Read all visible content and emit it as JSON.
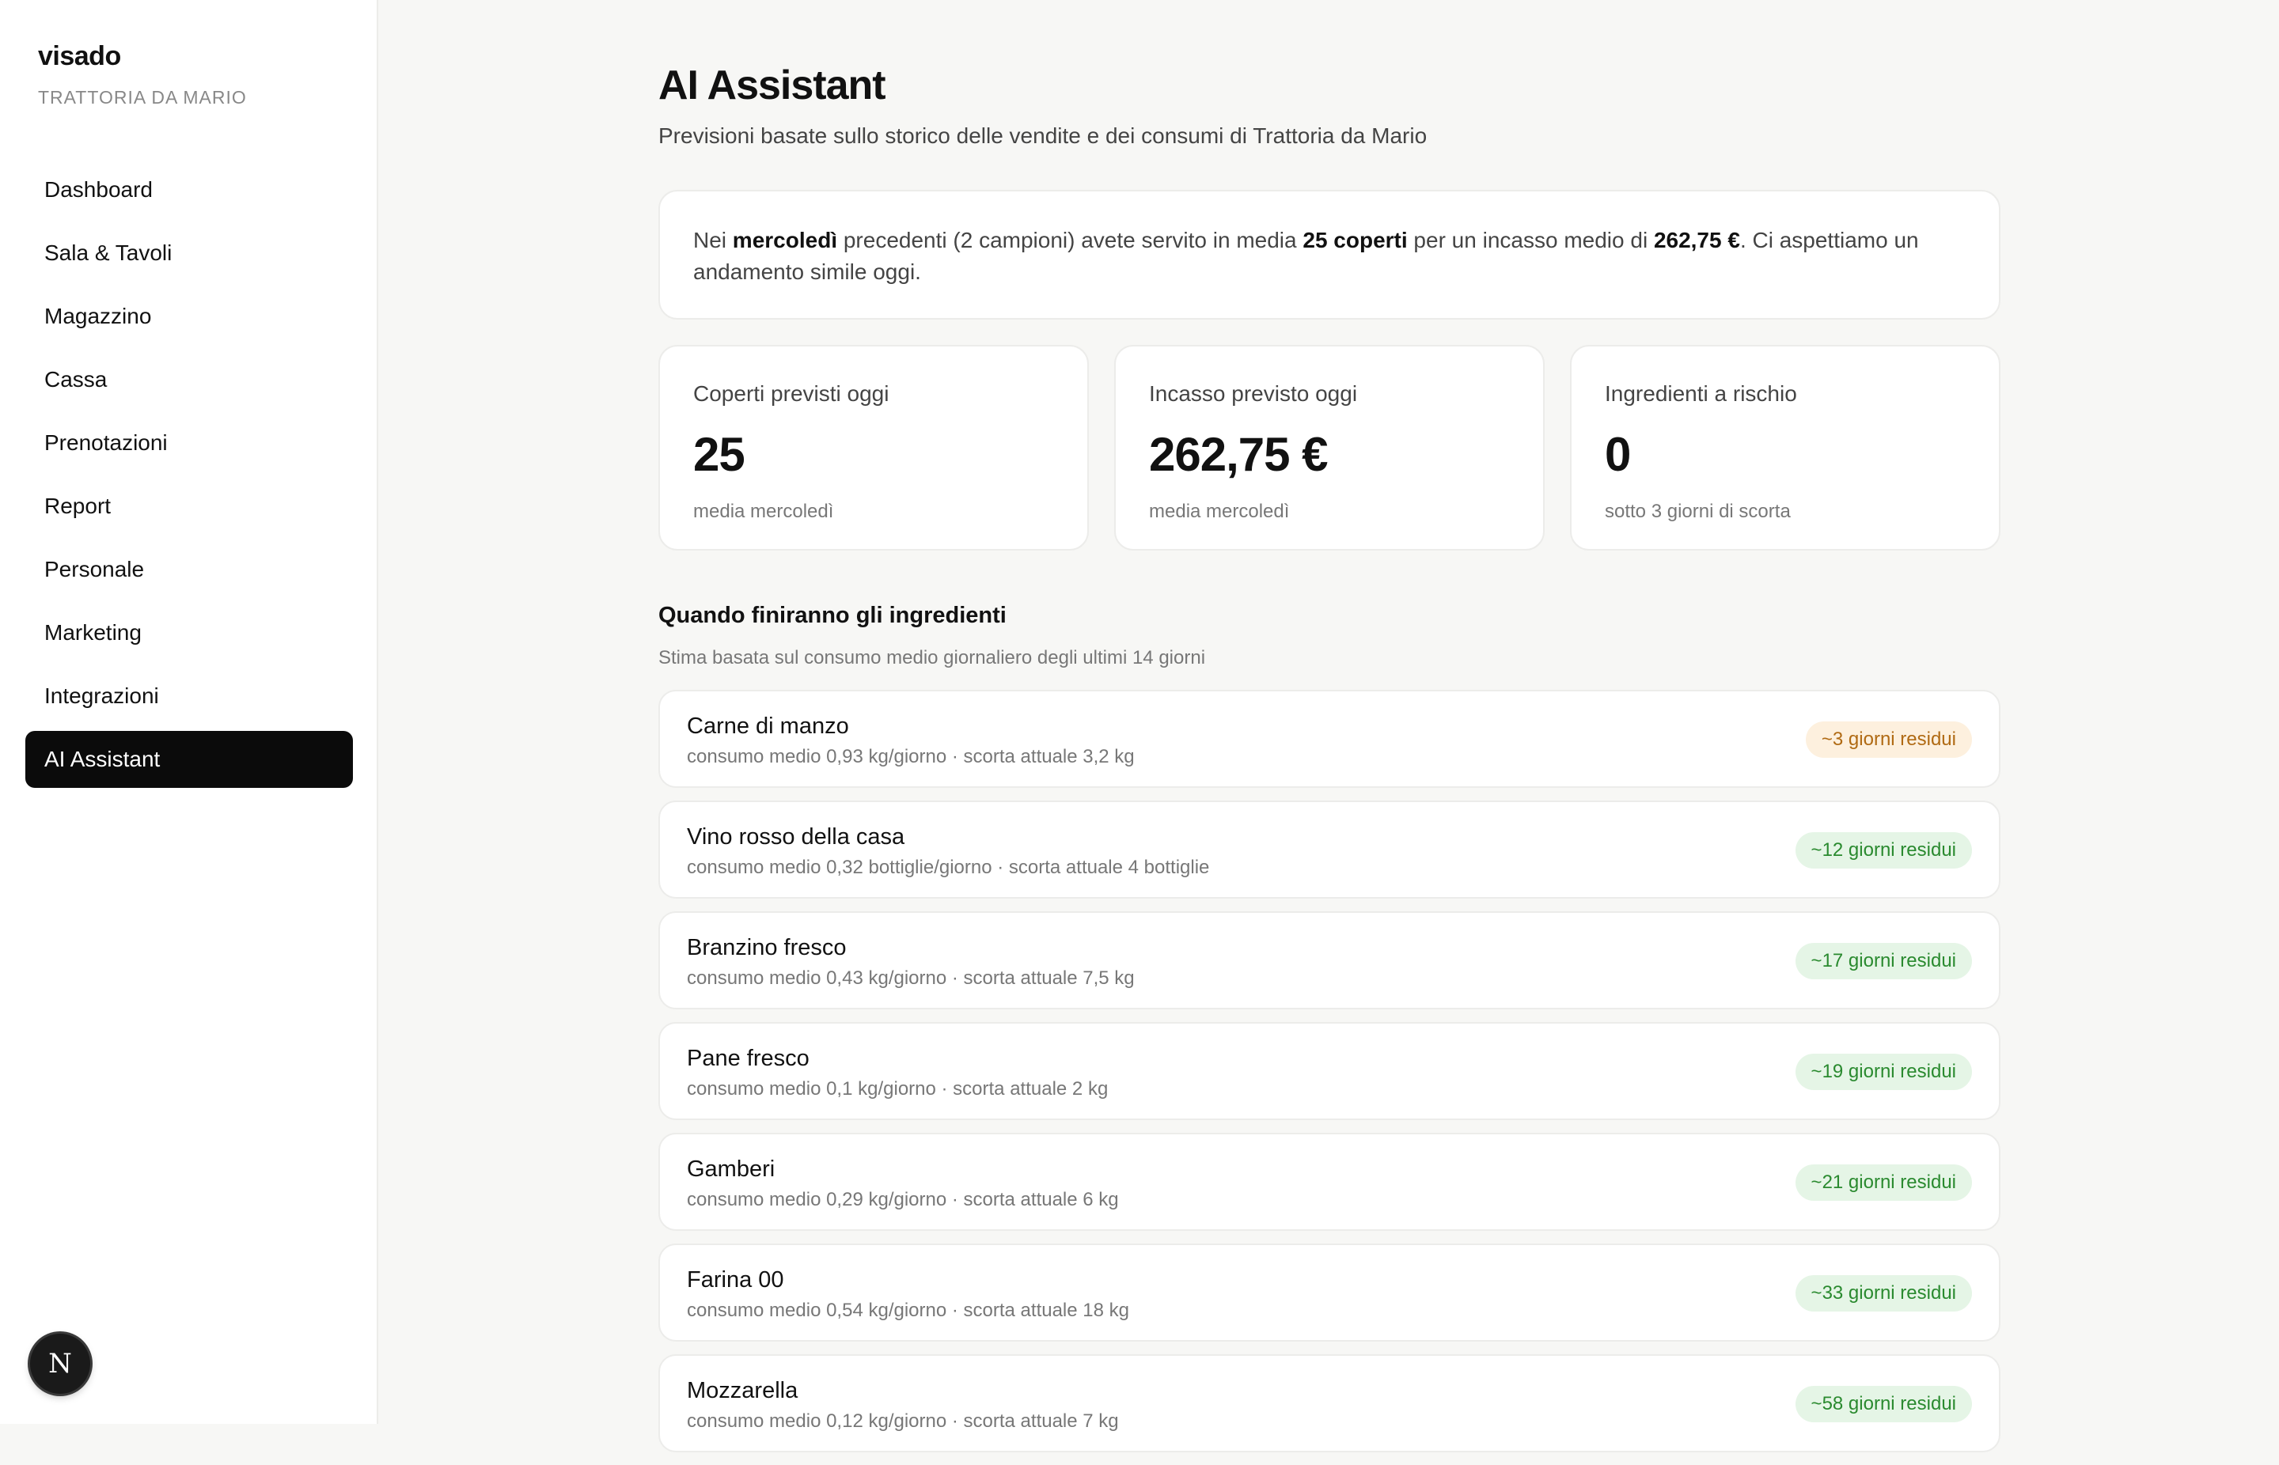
{
  "sidebar": {
    "brand": "visado",
    "org": "TRATTORIA DA MARIO",
    "items": [
      {
        "label": "Dashboard",
        "active": false
      },
      {
        "label": "Sala & Tavoli",
        "active": false
      },
      {
        "label": "Magazzino",
        "active": false
      },
      {
        "label": "Cassa",
        "active": false
      },
      {
        "label": "Prenotazioni",
        "active": false
      },
      {
        "label": "Report",
        "active": false
      },
      {
        "label": "Personale",
        "active": false
      },
      {
        "label": "Marketing",
        "active": false
      },
      {
        "label": "Integrazioni",
        "active": false
      },
      {
        "label": "AI Assistant",
        "active": true
      }
    ],
    "badge_letter": "N"
  },
  "header": {
    "title": "AI Assistant",
    "subtitle": "Previsioni basate sullo storico delle vendite e dei consumi di Trattoria da Mario"
  },
  "summary": {
    "t1": "Nei ",
    "b1": "mercoledì",
    "t2": " precedenti (2 campioni) avete servito in media ",
    "b2": "25 coperti",
    "t3": " per un incasso medio di ",
    "b3": "262,75 €",
    "t4": ". Ci aspettiamo un andamento simile oggi."
  },
  "stats": [
    {
      "label": "Coperti previsti oggi",
      "value": "25",
      "note": "media mercoledì"
    },
    {
      "label": "Incasso previsto oggi",
      "value": "262,75 €",
      "note": "media mercoledì"
    },
    {
      "label": "Ingredienti a rischio",
      "value": "0",
      "note": "sotto 3 giorni di scorta"
    }
  ],
  "ingredients_section": {
    "title": "Quando finiranno gli ingredienti",
    "subtitle": "Stima basata sul consumo medio giornaliero degli ultimi 14 giorni",
    "items": [
      {
        "name": "Carne di manzo",
        "meta": "consumo medio 0,93 kg/giorno · scorta attuale 3,2 kg",
        "days": "~3 giorni residui",
        "status": "warn"
      },
      {
        "name": "Vino rosso della casa",
        "meta": "consumo medio 0,32 bottiglie/giorno · scorta attuale 4 bottiglie",
        "days": "~12 giorni residui",
        "status": "ok"
      },
      {
        "name": "Branzino fresco",
        "meta": "consumo medio 0,43 kg/giorno · scorta attuale 7,5 kg",
        "days": "~17 giorni residui",
        "status": "ok"
      },
      {
        "name": "Pane fresco",
        "meta": "consumo medio 0,1 kg/giorno · scorta attuale 2 kg",
        "days": "~19 giorni residui",
        "status": "ok"
      },
      {
        "name": "Gamberi",
        "meta": "consumo medio 0,29 kg/giorno · scorta attuale 6 kg",
        "days": "~21 giorni residui",
        "status": "ok"
      },
      {
        "name": "Farina 00",
        "meta": "consumo medio 0,54 kg/giorno · scorta attuale 18 kg",
        "days": "~33 giorni residui",
        "status": "ok"
      },
      {
        "name": "Mozzarella",
        "meta": "consumo medio 0,12 kg/giorno · scorta attuale 7 kg",
        "days": "~58 giorni residui",
        "status": "ok"
      }
    ]
  }
}
